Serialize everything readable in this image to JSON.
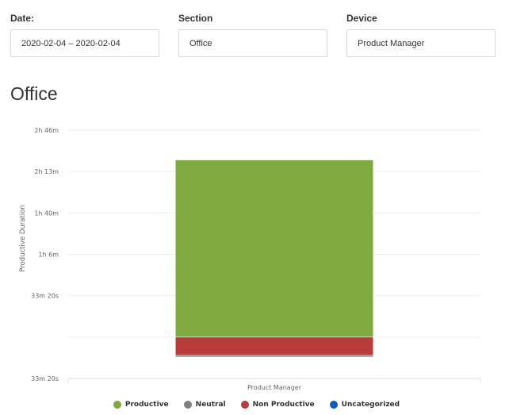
{
  "filters": {
    "date": {
      "label": "Date:",
      "value": "2020-02-04 – 2020-02-04"
    },
    "section": {
      "label": "Section",
      "value": "Office"
    },
    "device": {
      "label": "Device",
      "value": "Product Manager"
    }
  },
  "section_title": "Office",
  "colors": {
    "productive": "#7faa40",
    "neutral": "#808080",
    "non_productive": "#b83d3a",
    "uncategorized": "#0a5cc2",
    "grid": "#eeeeee",
    "axis": "#dde3ee"
  },
  "chart_data": {
    "type": "bar",
    "stacked": true,
    "title": "Office",
    "xlabel": "",
    "ylabel": "Productive Duration",
    "categories": [
      "Product Manager"
    ],
    "y_unit": "seconds",
    "ylim": [
      -2000,
      10000
    ],
    "y_ticks": [
      {
        "value": -2000,
        "label": "33m 20s"
      },
      {
        "value": 0,
        "label": ""
      },
      {
        "value": 2000,
        "label": "33m 20s"
      },
      {
        "value": 4000,
        "label": "1h 6m"
      },
      {
        "value": 6000,
        "label": "1h 40m"
      },
      {
        "value": 8000,
        "label": "2h 13m"
      },
      {
        "value": 10000,
        "label": "2h 46m"
      }
    ],
    "grid": true,
    "legend_position": "bottom",
    "series": [
      {
        "key": "productive",
        "name": "Productive",
        "values": [
          8560
        ]
      },
      {
        "key": "neutral",
        "name": "Neutral",
        "values": [
          -80
        ]
      },
      {
        "key": "non_productive",
        "name": "Non Productive",
        "values": [
          -880
        ]
      },
      {
        "key": "uncategorized",
        "name": "Uncategorized",
        "values": [
          0
        ]
      }
    ]
  }
}
